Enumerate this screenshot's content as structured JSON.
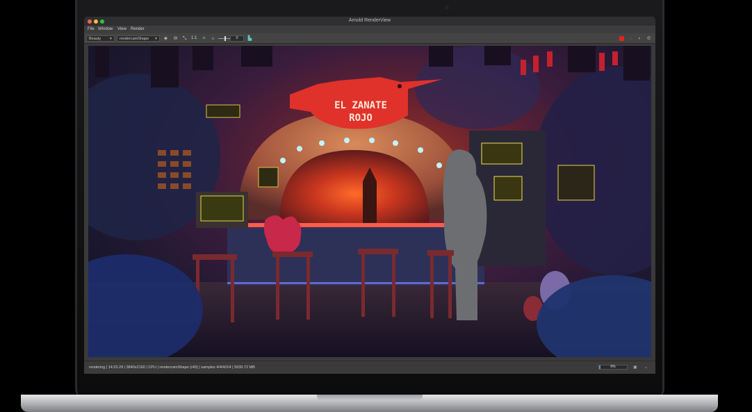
{
  "window": {
    "title": "Arnold RenderView"
  },
  "menubar": {
    "items": [
      "File",
      "Window",
      "View",
      "Render"
    ]
  },
  "toolbar": {
    "aov_select": "Beauty",
    "camera_select": "rendercamShape",
    "zoom_label": "1:1",
    "exposure_value": "0"
  },
  "viewport": {
    "sign_text_line1": "EL ZANATE",
    "sign_text_line2": "ROJO"
  },
  "statusbar": {
    "text": "rendering | 14:23.29 | 3840x2160 | CPU | rendercamShape (r49) | samples 4/4/4/2/4 | 5630.72 MB",
    "progress_label": "6%",
    "progress": 0.06
  },
  "colors": {
    "accent_stop": "#e02323",
    "progress": "#5f8fb5"
  }
}
